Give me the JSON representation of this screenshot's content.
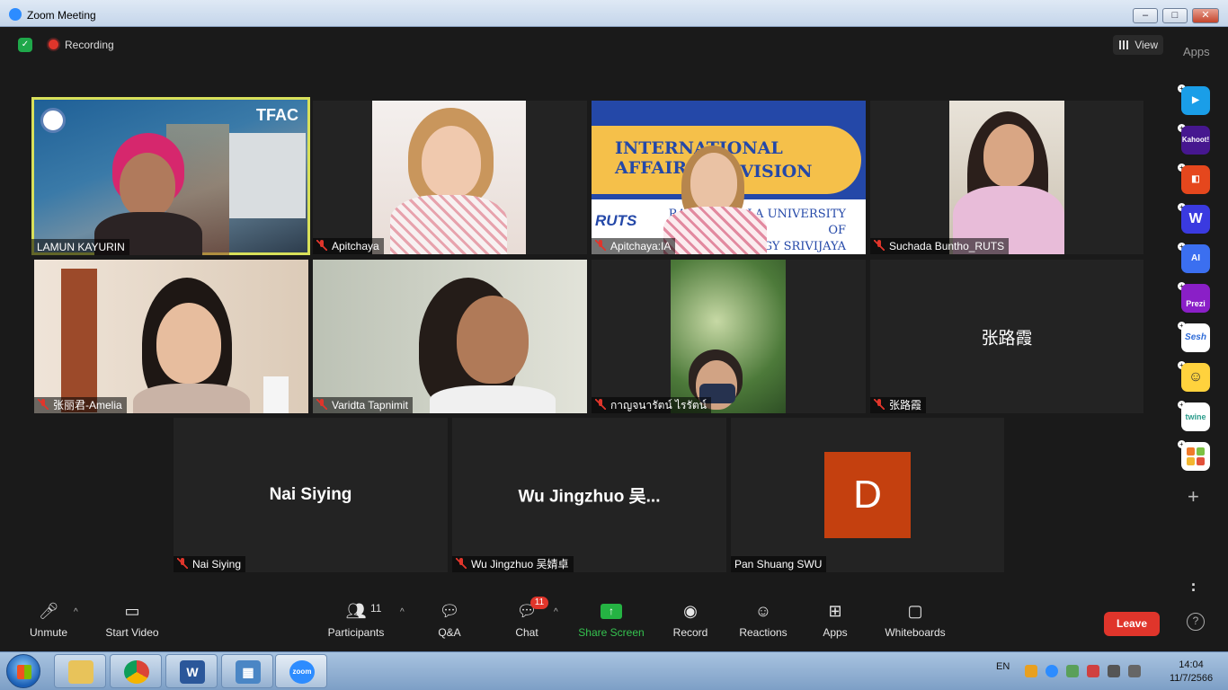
{
  "window": {
    "title": "Zoom Meeting",
    "minimize": "–",
    "maximize": "□",
    "close": "✕"
  },
  "topbar": {
    "recording_label": "Recording",
    "view_label": "View",
    "apps_label": "Apps"
  },
  "tiles": {
    "lamun": {
      "name": "LAMUN KAYURIN",
      "overlay_text": "TFAC"
    },
    "apitchaya": {
      "name": "Apitchaya"
    },
    "apitchaya_ia": {
      "name": "Apitchaya:IA",
      "banner_line1": "INTERNATIONAL AFFAIRS",
      "banner_line2": "DIVISION",
      "banner_line3": "RAJAMANGALA UNIVERSITY OF",
      "banner_line4": "TECHNOLOGY SRIVIJAYA",
      "logo": "RUTS"
    },
    "suchada": {
      "name": "Suchada Buntho_RUTS"
    },
    "amelia": {
      "name": "张丽君-Amelia"
    },
    "varidta": {
      "name": "Varidta Tapnimit"
    },
    "kanjana": {
      "name": "กาญจนารัตน์ ไรรัตน์"
    },
    "zhanglux": {
      "name": "张路霞",
      "big_name": "张路霞"
    },
    "nai": {
      "name": "Nai Siying",
      "big_name": "Nai Siying"
    },
    "wu": {
      "name": "Wu Jingzhuo 吴婧卓",
      "big_name": "Wu  Jingzhuo 吴..."
    },
    "pan": {
      "name": "Pan Shuang SWU",
      "avatar_letter": "D"
    }
  },
  "sidebar_apps": [
    "Kahoot!",
    "Prezi",
    "Sesh",
    "twine"
  ],
  "toolbar": {
    "unmute": "Unmute",
    "start_video": "Start Video",
    "participants": "Participants",
    "participants_count": "11",
    "qa": "Q&A",
    "chat": "Chat",
    "chat_badge": "11",
    "share_screen": "Share Screen",
    "record": "Record",
    "reactions": "Reactions",
    "apps": "Apps",
    "whiteboards": "Whiteboards",
    "leave": "Leave",
    "help": "?"
  },
  "taskbar": {
    "zoom_label": "zoom",
    "word_label": "W",
    "language": "EN",
    "time": "14:04",
    "date": "11/7/2566"
  },
  "colors": {
    "accent_green": "#25b343",
    "leave_red": "#e0352b",
    "active_speaker": "#d8e05a",
    "avatar_orange": "#c4400f"
  }
}
